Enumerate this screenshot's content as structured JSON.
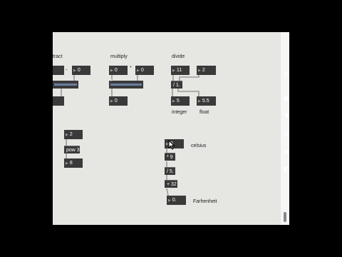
{
  "labels": {
    "subtract": "tract",
    "multiply": "multiply",
    "divide": "divide",
    "integer": "integer",
    "float": "float",
    "celsius": "celsius",
    "farenheit": "Farhenheit"
  },
  "operators": {
    "minus": "-",
    "times": "*"
  },
  "subtract": {
    "left": "",
    "right": "0",
    "out": ""
  },
  "multiply": {
    "left": "0",
    "right": "0",
    "op": "*",
    "out": "0"
  },
  "divide": {
    "left": "11",
    "right": "2",
    "op": "/ 1.",
    "int_out": "5",
    "float_out": "5.5"
  },
  "pow": {
    "in": "2",
    "op": "pow 3",
    "out": "8"
  },
  "temp": {
    "celsius": "0",
    "mul": "* 9",
    "div": "/ 5.",
    "add": "+ 32",
    "out": "0."
  },
  "tools": [
    "presentation-icon",
    "info-icon",
    "inspector-icon",
    "list-icon",
    "clipboard-icon",
    "debug-icon"
  ]
}
